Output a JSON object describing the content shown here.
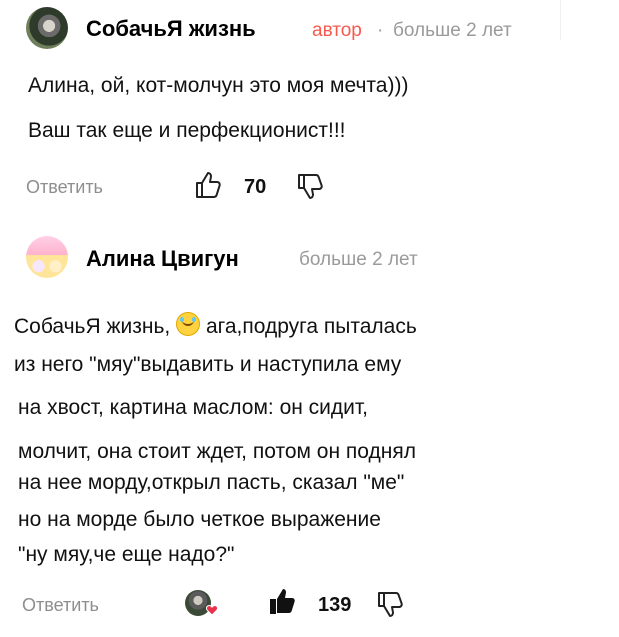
{
  "comments": [
    {
      "author": "СобачьЯ жизнь",
      "badge": "автор",
      "separator": "·",
      "time": "больше 2 лет",
      "lines": [
        "Алина, ой, кот-молчун это моя мечта)))",
        "Ваш так еще и перфекционист!!!"
      ],
      "reply_label": "Ответить",
      "likes": "70"
    },
    {
      "author": "Алина Цвигун",
      "time": "больше 2 лет",
      "lines": [
        "СобачьЯ жизнь,",
        "ага,подруга пыталась",
        "из него \"мяу\"выдавить и наступила ему",
        "на хвост, картина маслом: он сидит,",
        "молчит,  она стоит ждет, потом он поднял",
        "на  нее морду,открыл пасть, сказал \"ме\"",
        "но на морде было четкое выражение",
        "\"ну  мяу,че еще надо?\""
      ],
      "reply_label": "Ответить",
      "likes": "139"
    }
  ],
  "colors": {
    "badge": "#f55a4e",
    "muted": "#9a9a9a",
    "text": "#111111"
  },
  "icons": {
    "like_outline": "thumb-up-outline-icon",
    "like_filled": "thumb-up-filled-icon",
    "dislike": "thumb-down-outline-icon",
    "emoji": "laughing-sweat-emoji-icon",
    "heart": "heart-icon"
  }
}
